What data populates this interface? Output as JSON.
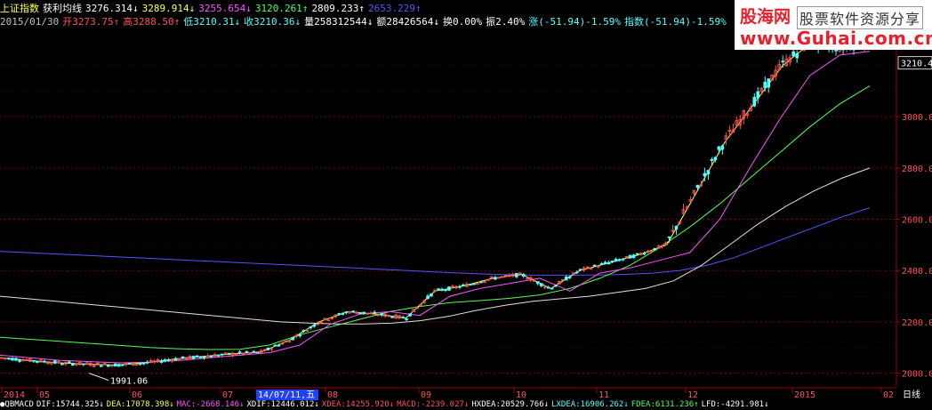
{
  "header": {
    "row1": [
      {
        "text": "上证指数",
        "color": "yellow"
      },
      {
        "text": "获利均线",
        "color": "white"
      },
      {
        "text": "3276.314↓",
        "color": "white"
      },
      {
        "text": "3289.914↓",
        "color": "yellow"
      },
      {
        "text": "3255.654↓",
        "color": "magenta"
      },
      {
        "text": "3120.261↑",
        "color": "green"
      },
      {
        "text": "2809.233↑",
        "color": "white"
      },
      {
        "text": "2653.229↑",
        "color": "blue"
      }
    ],
    "row2": [
      {
        "text": "2015/01/30",
        "color": "grey"
      },
      {
        "text": "开3273.75↑",
        "color": "red"
      },
      {
        "text": "高3288.50↑",
        "color": "red"
      },
      {
        "text": "低3210.31↓",
        "color": "cyan"
      },
      {
        "text": "收3210.36↓",
        "color": "cyan"
      },
      {
        "text": "量258312544↓",
        "color": "white"
      },
      {
        "text": "额28426564↓",
        "color": "white"
      },
      {
        "text": "换0.00%",
        "color": "white"
      },
      {
        "text": "振2.40%",
        "color": "white"
      },
      {
        "text": "涨(-51.94)-1.59%",
        "color": "cyan"
      },
      {
        "text": "指数(-51.94)-1.59%",
        "color": "cyan"
      }
    ]
  },
  "logo": {
    "line1": "股海网",
    "line1b": "股票软件资源分享",
    "line2": "www.Guhai.com.cn"
  },
  "price_axis": {
    "ticks": [
      "3000.0",
      "2800.0",
      "2600.0",
      "2400.0",
      "2200.0",
      "2000.0"
    ],
    "current": "3210.4"
  },
  "time_axis": {
    "labels": [
      "2014",
      "05",
      "06",
      "07",
      "14/07/11,五",
      "08",
      "09",
      "10",
      "11",
      "12",
      "2015",
      "02"
    ],
    "period": "日线"
  },
  "annotation": {
    "low_label": "1991.06"
  },
  "bottom_bar": [
    {
      "text": "●QBMACD",
      "color": "white"
    },
    {
      "text": "DIF:15744.325↓",
      "color": "white"
    },
    {
      "text": "DEA:17078.398↓",
      "color": "yellow"
    },
    {
      "text": "MAC:-2668.146↓",
      "color": "magenta"
    },
    {
      "text": "XDIF:12446.012↓",
      "color": "white"
    },
    {
      "text": "XDEA:14255.920↓",
      "color": "red"
    },
    {
      "text": "MACD:-2239.027↓",
      "color": "red"
    },
    {
      "text": "HXDEA:20529.766↓",
      "color": "white"
    },
    {
      "text": "LXDEA:16906.262↓",
      "color": "cyan"
    },
    {
      "text": "FDEA:6131.236↑",
      "color": "green"
    },
    {
      "text": "LFD:-4291.981↓",
      "color": "white"
    }
  ],
  "colors": {
    "background": "#000000",
    "grid": "#800000",
    "up": "#ff5454",
    "down": "#54ffff",
    "ma5": "#ffffff",
    "ma10": "#ffff54",
    "ma20": "#ff54ff",
    "ma60": "#54ff54",
    "ma120": "#e0e0e0",
    "ma250": "#5454ff"
  },
  "chart_data": {
    "type": "line",
    "y_axis": {
      "range": [
        1950,
        3330
      ]
    },
    "series": [
      {
        "line": "ma250",
        "values": [
          2475,
          2470,
          2465,
          2460,
          2455,
          2450,
          2445,
          2440,
          2435,
          2430,
          2425,
          2420,
          2415,
          2410,
          2405,
          2400,
          2395,
          2390,
          2386,
          2383,
          2382,
          2382,
          2383,
          2385,
          2390,
          2400,
          2420,
          2450,
          2490,
          2530,
          2570,
          2610,
          2645
        ]
      },
      {
        "line": "ma120",
        "values": [
          2300,
          2290,
          2280,
          2270,
          2260,
          2250,
          2240,
          2230,
          2220,
          2210,
          2200,
          2195,
          2192,
          2192,
          2195,
          2205,
          2222,
          2245,
          2265,
          2280,
          2290,
          2300,
          2315,
          2330,
          2360,
          2420,
          2500,
          2580,
          2650,
          2710,
          2760,
          2800
        ]
      },
      {
        "line": "ma60",
        "values": [
          2140,
          2132,
          2124,
          2116,
          2108,
          2100,
          2095,
          2092,
          2093,
          2110,
          2150,
          2180,
          2210,
          2240,
          2260,
          2275,
          2283,
          2292,
          2305,
          2330,
          2370,
          2420,
          2490,
          2570,
          2660,
          2760,
          2860,
          2960,
          3050,
          3120
        ]
      },
      {
        "line": "ma20",
        "values": [
          2070,
          2060,
          2050,
          2045,
          2040,
          2043,
          2050,
          2060,
          2070,
          2080,
          2110,
          2190,
          2230,
          2240,
          2225,
          2300,
          2330,
          2350,
          2370,
          2320,
          2390,
          2410,
          2440,
          2470,
          2600,
          2800,
          2990,
          3160,
          3240,
          3255
        ]
      },
      {
        "line": "ma10",
        "values": [
          2060,
          2050,
          2040,
          2035,
          2032,
          2040,
          2055,
          2065,
          2075,
          2082,
          2130,
          2200,
          2240,
          2230,
          2215,
          2320,
          2340,
          2370,
          2385,
          2330,
          2400,
          2430,
          2460,
          2500,
          2700,
          2900,
          3050,
          3200,
          3290,
          3270,
          3290
        ]
      }
    ]
  }
}
